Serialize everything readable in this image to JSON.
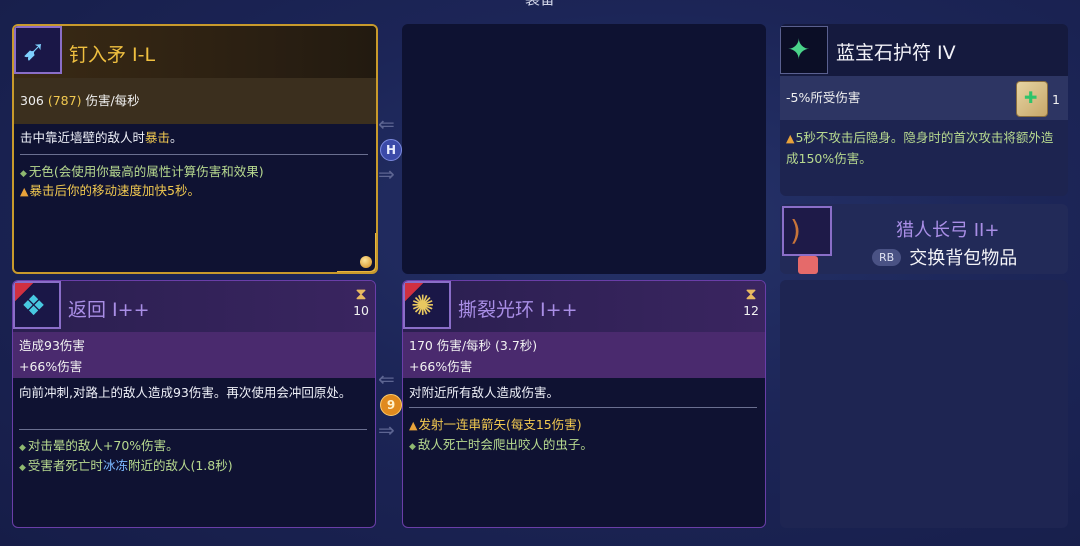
{
  "screen_title": "装备",
  "primary_weapon": {
    "name": "钉入矛 I-L",
    "icon": "spear-icon",
    "stat": {
      "dps": "306",
      "dps_bonus": "(787)",
      "unit": "伤害/每秒"
    },
    "description": {
      "prefix": "击中靠近墙壁的敌人时",
      "keyword": "暴击",
      "suffix": "。"
    },
    "effects": [
      {
        "bullet": "dot",
        "text": "无色(会使用你最高的属性计算伤害和效果)"
      },
      {
        "bullet": "star",
        "keyword": "暴击",
        "text": "后你的移动速度加快5秒。"
      }
    ]
  },
  "amulet": {
    "name": "蓝宝石护符 IV",
    "icon": "amulet-icon",
    "stat": "-5%所受伤害",
    "scroll_count": "1",
    "effect": "5秒不攻击后隐身。隐身时的首次攻击将额外造成150%伤害。"
  },
  "swap_item": {
    "name": "猎人长弓 II+",
    "icon": "longbow-icon",
    "button_label": "RB",
    "action_label": "交换背包物品"
  },
  "skill_left": {
    "name": "返回 I++",
    "icon": "return-skill-icon",
    "cooldown": "10",
    "stats": [
      "造成93伤害",
      "+66%伤害"
    ],
    "description": "向前冲刺,对路上的敌人造成93伤害。再次使用会冲回原处。",
    "effects": [
      {
        "bullet": "dot",
        "text": "对击晕的敌人+70%伤害。"
      },
      {
        "bullet": "dot",
        "prefix": "受害者死亡时",
        "keyword": "冰冻",
        "suffix": "附近的敌人(1.8秒)"
      }
    ]
  },
  "skill_right": {
    "name": "撕裂光环 I++",
    "icon": "aura-skill-icon",
    "cooldown": "12",
    "stats": [
      "170 伤害/每秒 (3.7秒)",
      "+66%伤害"
    ],
    "description": "对附近所有敌人造成伤害。",
    "effects": [
      {
        "bullet": "star",
        "text": "发射一连串箭矢(每支15伤害)"
      },
      {
        "bullet": "dot",
        "text": "敌人死亡时会爬出咬人的虫子。"
      }
    ]
  },
  "swap_badges": {
    "weapons": "H",
    "skills": "9"
  },
  "colors": {
    "gold_frame": "#c89a2c",
    "legendary_title": "#f0c040",
    "purple_title": "#a98ee6",
    "effect_green": "#b7d98f",
    "effect_yellow": "#f0c850"
  }
}
